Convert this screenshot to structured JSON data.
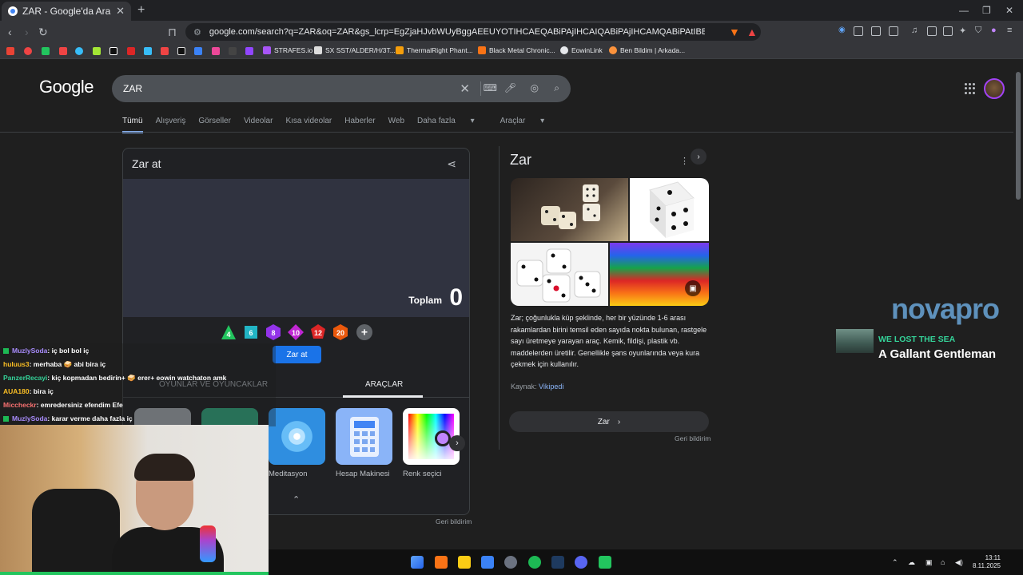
{
  "browser": {
    "tab_title": "ZAR - Google'da Ara",
    "url": "google.com/search?q=ZAR&oq=ZAR&gs_lcrp=EgZjaHJvbWUyBggAEEUYOTIHCAEQABiPAjIHCAIQABiPAjIHCAMQABiPAtIBBzY4N2owajGoAgCwAgA&..."
  },
  "bookmarks": [
    {
      "label": "STRAFES.io"
    },
    {
      "label": "SX SST/ALDER/H/3T..."
    },
    {
      "label": "ThermalRight Phant..."
    },
    {
      "label": "Black Metal Chronic..."
    },
    {
      "label": "EowinLink"
    },
    {
      "label": "Ben Bildim | Arkada..."
    }
  ],
  "google": {
    "logo": "Google",
    "query": "ZAR",
    "tabs": [
      "Tümü",
      "Alışveriş",
      "Görseller",
      "Videolar",
      "Kısa videolar",
      "Haberler",
      "Web",
      "Daha fazla",
      "Araçlar"
    ]
  },
  "dice_widget": {
    "title": "Zar at",
    "total_label": "Toplam",
    "total_value": "0",
    "dice": [
      "4",
      "6",
      "8",
      "10",
      "12",
      "20"
    ],
    "roll_button": "Zar at",
    "tabs": [
      "OYUNLAR VE OYUNCAKLAR",
      "ARAÇLAR"
    ],
    "tools": [
      {
        "label": "Meditasyon"
      },
      {
        "label": "Hesap Makinesi"
      },
      {
        "label": "Renk seçici"
      }
    ],
    "feedback": "Geri bildirim"
  },
  "knowledge_panel": {
    "title": "Zar",
    "description": "Zar; çoğunlukla küp şeklinde, her bir yüzünde 1-6 arası rakamlardan birini temsil eden sayıda nokta bulunan, rastgele sayı üretmeye yarayan araç. Kemik, fildişi, plastik vb. maddelerden üretilir. Genellikle şans oyunlarında veya kura çekmek için kullanılır.",
    "source_label": "Kaynak:",
    "source_link": "Vikipedi",
    "button": "Zar",
    "feedback": "Geri bildirim"
  },
  "overlay": {
    "brand": "novapro",
    "now_playing_sub": "WE LOST THE SEA",
    "now_playing_title": "A Gallant Gentleman"
  },
  "chat": [
    {
      "user": "MuzlySoda",
      "msg": ": iç bol bol iç",
      "color": "#a78bfa",
      "badge": true
    },
    {
      "user": "huluus3",
      "msg": ": merhaba 🥪 abi bira iç",
      "color": "#fbbf24",
      "badge": false
    },
    {
      "user": "PanzerRecayi",
      "msg": ": kiç kopmadan bedirin+ 🥪 erer+ eowin watchaton amk",
      "color": "#34d399",
      "badge": false
    },
    {
      "user": "AUA180",
      "msg": ": bira iç",
      "color": "#fbbf24",
      "badge": false
    },
    {
      "user": "Miccheckr",
      "msg": ": emredersiniz efendim Efe",
      "color": "#f87171",
      "badge": false
    },
    {
      "user": "MuzlySoda",
      "msg": ": karar verme daha fazla iç",
      "color": "#a78bfa",
      "badge": true
    }
  ],
  "taskbar": {
    "time": "13:11",
    "date": "8.11.2025"
  },
  "colors": {
    "accent": "#1a73e8",
    "link": "#8ab4f8",
    "background": "#1f1f1f"
  }
}
